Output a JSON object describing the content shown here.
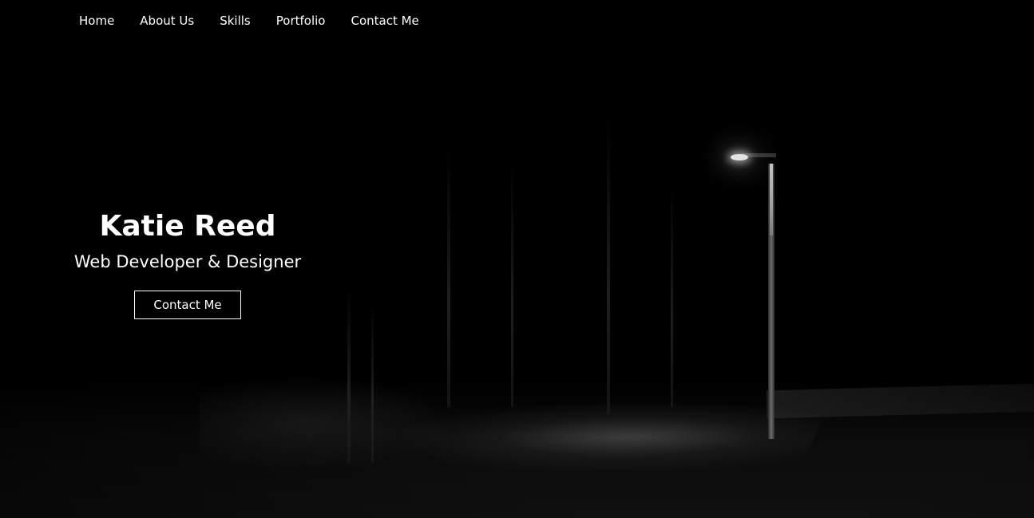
{
  "nav": {
    "items": [
      {
        "label": "Home"
      },
      {
        "label": "About Us"
      },
      {
        "label": "Skills"
      },
      {
        "label": "Portfolio"
      },
      {
        "label": "Contact Me"
      }
    ]
  },
  "hero": {
    "name": "Katie Reed",
    "title": "Web Developer & Designer",
    "button_label": "Contact Me"
  },
  "colors": {
    "background": "#000000",
    "text": "#ffffff"
  }
}
